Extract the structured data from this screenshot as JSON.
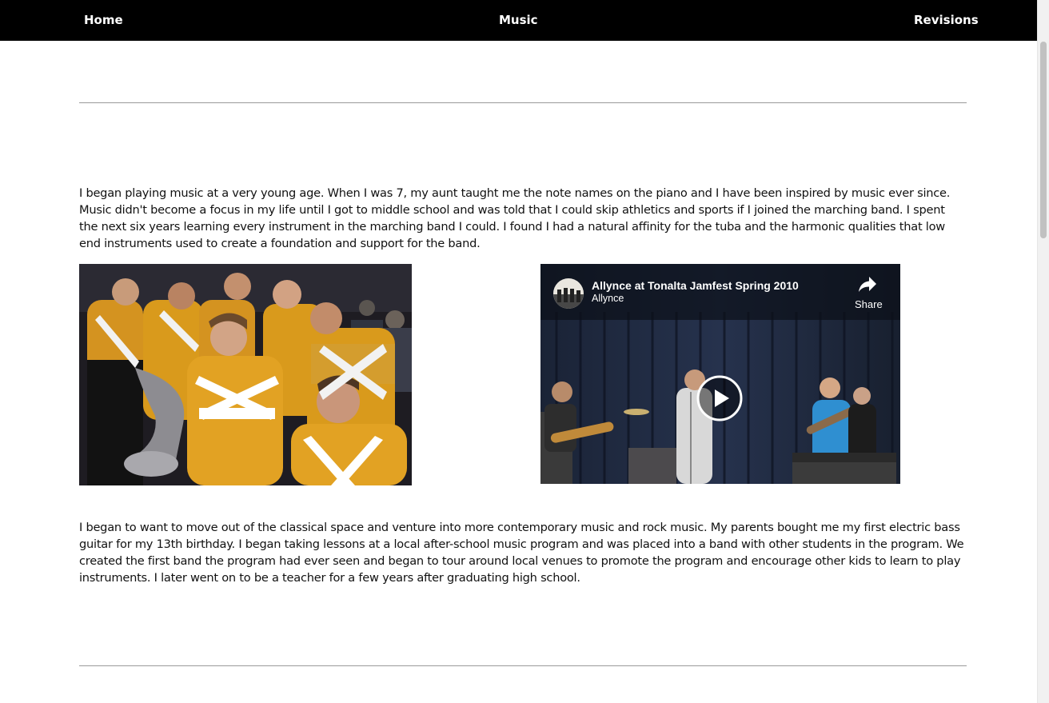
{
  "nav": {
    "home": "Home",
    "music": "Music",
    "revisions": "Revisions"
  },
  "content": {
    "paragraph_1": "I began playing music at a very young age. When I was 7, my aunt taught me the note names on the piano and I have been inspired by music ever since. Music didn't become a focus in my life until I got to middle school and was told that I could skip athletics and sports if I joined the marching band. I spent the next six years learning every instrument in the marching band I could. I found I had a natural affinity for the tuba and the harmonic qualities that low end instruments used to create a foundation and support for the band.",
    "paragraph_2": "I began to want to move out of the classical space and venture into more contemporary music and rock music. My parents bought me my first electric bass guitar for my 13th birthday. I began taking lessons at a local after-school music program and was placed into a band with other students in the program. We created the first band the program had ever seen and began to tour around local venues to promote the program and encourage other kids to learn to play instruments. I later went on to be a teacher for a few years after graduating high school."
  },
  "video": {
    "title": "Allynce at Tonalta Jamfest Spring 2010",
    "channel": "Allynce",
    "share_label": "Share"
  },
  "colors": {
    "nav_bg": "#000000",
    "nav_text": "#ffffff",
    "uniform_gold": "#d99a1c",
    "video_bg": "#101522"
  },
  "icons": {
    "share": "share-arrow-icon",
    "play": "play-circle-icon",
    "channel_avatar": "channel-avatar"
  }
}
